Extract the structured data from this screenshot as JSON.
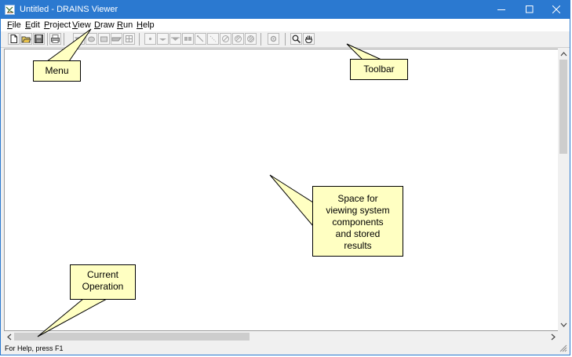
{
  "window": {
    "title": "Untitled - DRAINS Viewer",
    "controls": [
      "minimize",
      "maximize",
      "close"
    ]
  },
  "menu": {
    "items": [
      {
        "label": "File",
        "accel": "F"
      },
      {
        "label": "Edit",
        "accel": "E"
      },
      {
        "label": "Project",
        "accel": "P"
      },
      {
        "label": "View",
        "accel": "V"
      },
      {
        "label": "Draw",
        "accel": "D"
      },
      {
        "label": "Run",
        "accel": "R"
      },
      {
        "label": "Help",
        "accel": "H"
      }
    ]
  },
  "toolbar": {
    "buttons": [
      {
        "name": "new-file-icon",
        "enabled": true
      },
      {
        "name": "open-folder-icon",
        "enabled": true
      },
      {
        "name": "save-disk-icon",
        "enabled": true
      },
      {
        "name": "print-icon",
        "enabled": true
      },
      {
        "name": "pit-icon",
        "enabled": false
      },
      {
        "name": "node-icon",
        "enabled": false
      },
      {
        "name": "basin-icon",
        "enabled": false
      },
      {
        "name": "channel-icon",
        "enabled": false
      },
      {
        "name": "grid-table-icon",
        "enabled": false
      },
      {
        "name": "point-node-icon",
        "enabled": false
      },
      {
        "name": "inlet-icon",
        "enabled": false
      },
      {
        "name": "sag-inlet-icon",
        "enabled": false
      },
      {
        "name": "junction-icon",
        "enabled": false
      },
      {
        "name": "pipe-link-icon",
        "enabled": false
      },
      {
        "name": "overflow-link-icon",
        "enabled": false
      },
      {
        "name": "sub-catchment-icon",
        "enabled": false
      },
      {
        "name": "catchment-icon",
        "enabled": false
      },
      {
        "name": "region-icon",
        "enabled": false
      },
      {
        "name": "gear-icon",
        "enabled": false
      },
      {
        "name": "zoom-magnifier-icon",
        "enabled": true
      },
      {
        "name": "pan-hand-icon",
        "enabled": true
      }
    ]
  },
  "status": {
    "text": "For Help, press F1"
  },
  "annotations": {
    "menu": "Menu",
    "toolbar": "Toolbar",
    "space_lines": [
      "Space for",
      "viewing system",
      "components",
      "and stored",
      "results"
    ],
    "operation_lines": [
      "Current",
      "Operation"
    ]
  },
  "colors": {
    "titlebar": "#2b79d0",
    "callout_fill": "#ffffc2",
    "window_bg": "#f0f0f0"
  }
}
